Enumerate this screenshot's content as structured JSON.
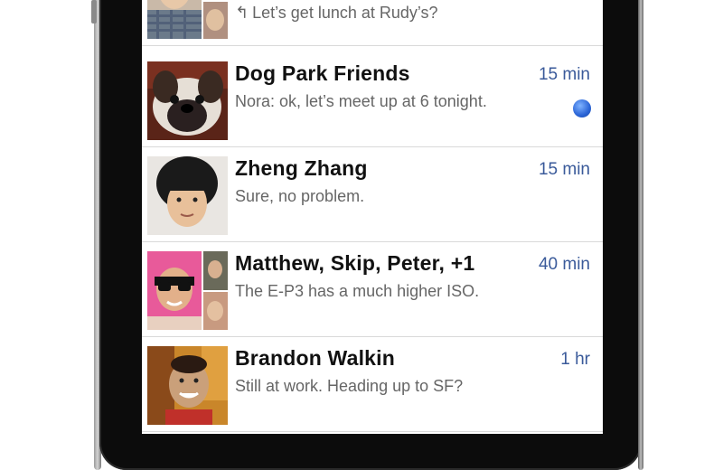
{
  "colors": {
    "time_text": "#3a5a9a",
    "unread_dot": "#2a64d6",
    "name_text": "#111111",
    "preview_text": "#666666"
  },
  "threads": [
    {
      "name": "",
      "time": "",
      "preview": "Let’s get lunch at Rudy’s?",
      "replied": true,
      "unread": false,
      "avatar_icon": "group-photo-avatar"
    },
    {
      "name": "Dog Park Friends",
      "time": "15 min",
      "preview": "Nora: ok, let’s meet up at 6 tonight.",
      "replied": false,
      "unread": true,
      "avatar_icon": "dog-photo-avatar"
    },
    {
      "name": "Zheng Zhang",
      "time": "15 min",
      "preview": "Sure, no problem.",
      "replied": false,
      "unread": false,
      "avatar_icon": "person-photo-avatar"
    },
    {
      "name": "Matthew, Skip, Peter, +1",
      "time": "40 min",
      "preview": "The E-P3 has a much higher ISO.",
      "replied": false,
      "unread": false,
      "avatar_icon": "group-photo-avatar"
    },
    {
      "name": "Brandon Walkin",
      "time": "1 hr",
      "preview": "Still at work. Heading up to SF?",
      "replied": false,
      "unread": false,
      "avatar_icon": "person-photo-avatar"
    }
  ]
}
